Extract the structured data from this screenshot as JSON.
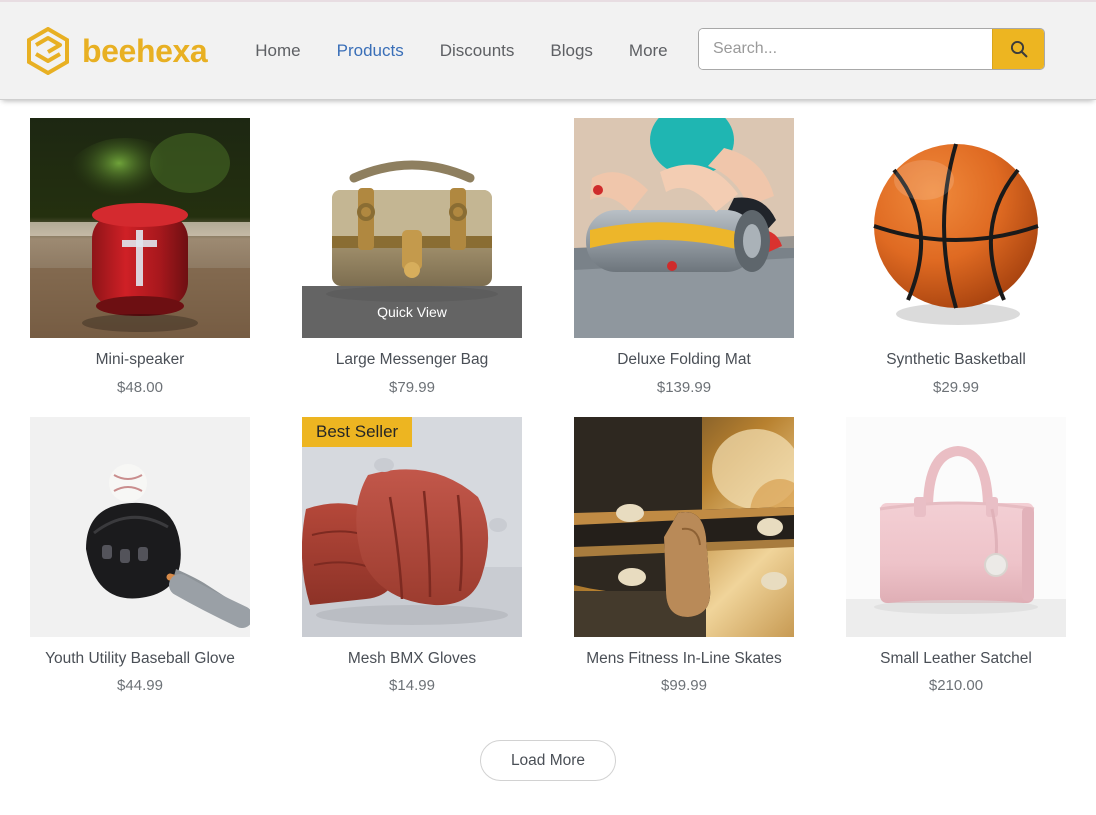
{
  "header": {
    "brand": {
      "name": "beehexa",
      "logo_icon": "hexagon-layers-icon",
      "color": "#e8b023"
    },
    "nav": [
      {
        "label": "Home",
        "active": false
      },
      {
        "label": "Products",
        "active": true
      },
      {
        "label": "Discounts",
        "active": false
      },
      {
        "label": "Blogs",
        "active": false
      },
      {
        "label": "More",
        "active": false
      }
    ],
    "search": {
      "placeholder": "Search...",
      "value": "",
      "button_icon": "search-icon",
      "button_color": "#edb521"
    }
  },
  "catalog": {
    "products": [
      {
        "title": "Mini-speaker",
        "price": "$48.00",
        "image_name": "red-bluetooth-speaker-photo",
        "badge": null,
        "quick_view": null
      },
      {
        "title": "Large Messenger Bag",
        "price": "$79.99",
        "image_name": "tan-canvas-messenger-bag-photo",
        "badge": null,
        "quick_view": "Quick View"
      },
      {
        "title": "Deluxe Folding Mat",
        "price": "$139.99",
        "image_name": "rolled-exercise-mat-photo",
        "badge": null,
        "quick_view": null
      },
      {
        "title": "Synthetic Basketball",
        "price": "$29.99",
        "image_name": "orange-basketball-photo",
        "badge": null,
        "quick_view": null
      },
      {
        "title": "Youth Utility Baseball Glove",
        "price": "$44.99",
        "image_name": "black-baseball-glove-photo",
        "badge": null,
        "quick_view": null
      },
      {
        "title": "Mesh BMX Gloves",
        "price": "$14.99",
        "image_name": "red-leather-gloves-photo",
        "badge": "Best Seller",
        "quick_view": null
      },
      {
        "title": "Mens Fitness In-Line Skates",
        "price": "$99.99",
        "image_name": "person-holding-skateboard-photo",
        "badge": null,
        "quick_view": null
      },
      {
        "title": "Small Leather Satchel",
        "price": "$210.00",
        "image_name": "pink-leather-handbag-photo",
        "badge": null,
        "quick_view": null
      }
    ],
    "load_more_label": "Load More"
  }
}
